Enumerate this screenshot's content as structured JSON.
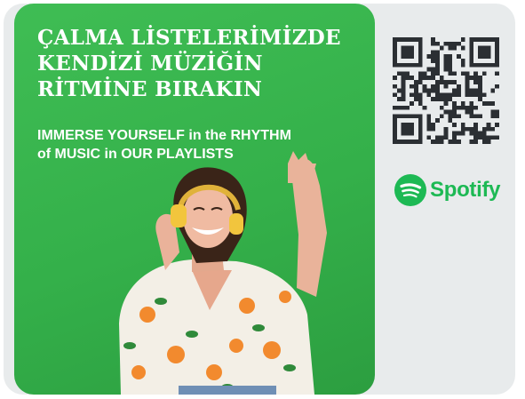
{
  "headline_tr": {
    "line1": "ÇALMA LİSTELERİMİZDE",
    "line2": "KENDİZİ MÜZİĞİN",
    "line3": "RİTMİNE BIRAKIN"
  },
  "headline_en": {
    "line1": "IMMERSE YOURSELF in the RHYTHM",
    "line2": "of MUSIC in OUR PLAYLISTS"
  },
  "brand": {
    "name": "Spotify",
    "color": "#1db954"
  },
  "colors": {
    "hero_green": "#34b04a",
    "panel_gray": "#e8ebec"
  },
  "icons": [
    "qr-code-icon",
    "spotify-logo-icon"
  ]
}
